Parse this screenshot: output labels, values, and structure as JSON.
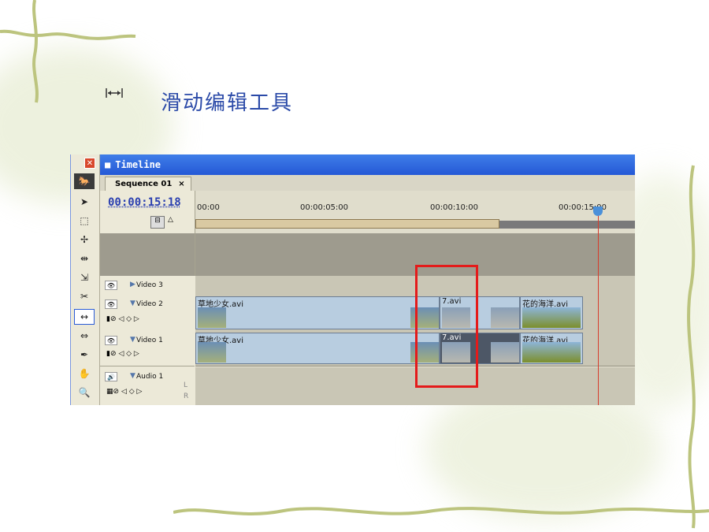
{
  "slide": {
    "title": "滑动编辑工具",
    "icon": "slip-tool-icon"
  },
  "window": {
    "title": "Timeline",
    "tab": "Sequence 01",
    "tab_close": "×",
    "close_glyph": "✕"
  },
  "timecode": "00:00:15:18",
  "ruler": {
    "labels": [
      "00:00",
      "00:00:05:00",
      "00:00:10:00",
      "00:00:15:00"
    ]
  },
  "tracks": [
    {
      "name": "Video 3"
    },
    {
      "name": "Video 2",
      "clips": [
        "草地少女.avi",
        "7.avi",
        "花的海洋.avi"
      ]
    },
    {
      "name": "Video 1",
      "clips": [
        "草地少女.avi",
        "7.avi",
        "花的海洋.avi"
      ]
    },
    {
      "name": "Audio 1"
    }
  ],
  "audio_lr": [
    "L",
    "R"
  ],
  "tools": [
    "selection-tool",
    "track-select-tool",
    "ripple-edit-tool",
    "rolling-edit-tool",
    "rate-stretch-tool",
    "razor-tool",
    "slip-tool",
    "slide-tool",
    "pen-tool",
    "hand-tool",
    "zoom-tool"
  ],
  "colors": {
    "title_blue": "#2b4aa8",
    "highlight_red": "#e41b1b",
    "titlebar_blue": "#2458d6"
  }
}
